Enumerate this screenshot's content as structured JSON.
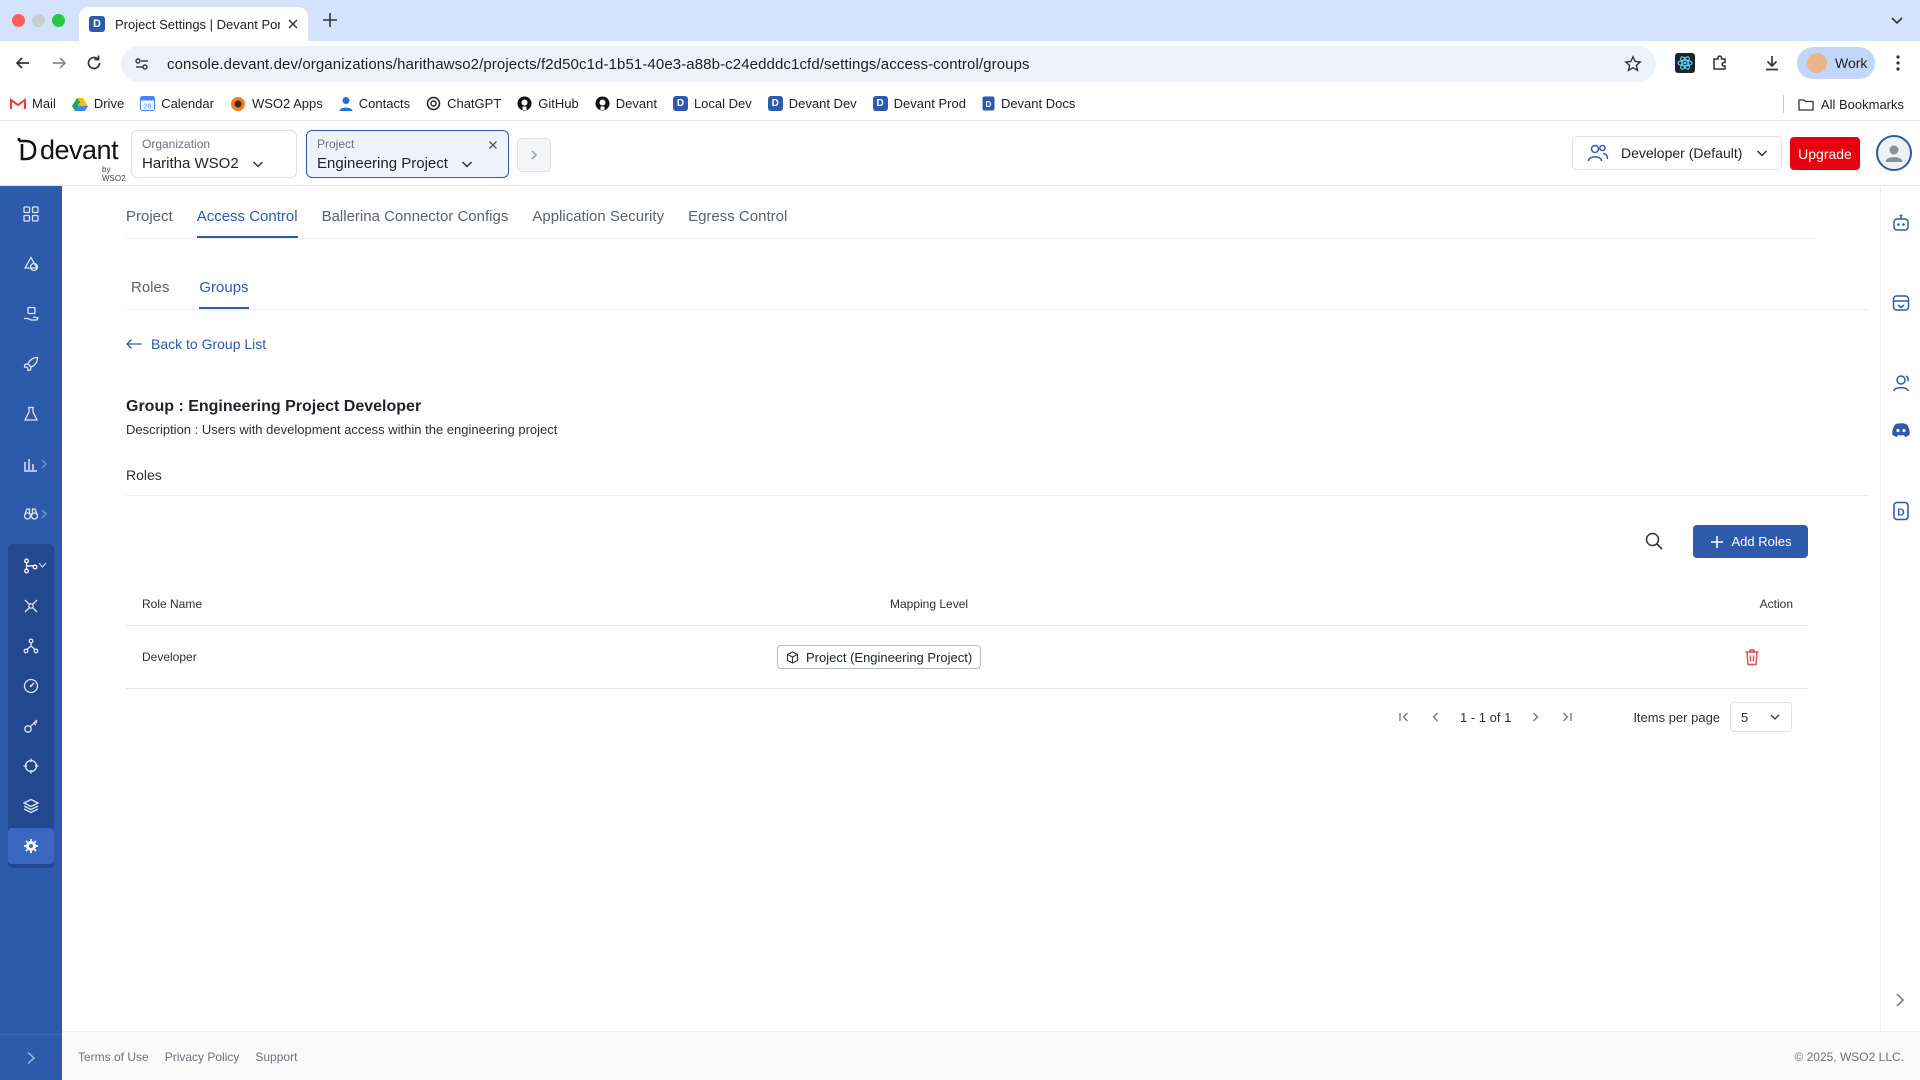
{
  "browser": {
    "tab_title": "Project Settings | Devant Portal",
    "url": "console.devant.dev/organizations/harithawso2/projects/f2d50c1d-1b51-40e3-a88b-c24edddc1cfd/settings/access-control/groups",
    "profile_label": "Work",
    "bookmarks": [
      "Mail",
      "Drive",
      "Calendar",
      "WSO2 Apps",
      "Contacts",
      "ChatGPT",
      "GitHub",
      "Devant",
      "Local Dev",
      "Devant Dev",
      "Devant Prod",
      "Devant Docs"
    ],
    "all_bookmarks": "All Bookmarks"
  },
  "header": {
    "logo_text": "devant",
    "logo_by": "by WSO2",
    "org_label": "Organization",
    "org_value": "Haritha WSO2",
    "project_label": "Project",
    "project_value": "Engineering Project",
    "role_switch": "Developer (Default)",
    "upgrade_label": "Upgrade"
  },
  "settings_tabs": [
    "Project",
    "Access Control",
    "Ballerina Connector Configs",
    "Application Security",
    "Egress Control"
  ],
  "access_tabs": [
    "Roles",
    "Groups"
  ],
  "group": {
    "back_label": "Back to Group List",
    "title": "Group : Engineering Project Developer",
    "description": "Description : Users with development access within the engineering project",
    "roles_heading": "Roles",
    "add_roles_label": "Add Roles"
  },
  "table": {
    "columns": [
      "Role Name",
      "Mapping Level",
      "Action"
    ],
    "rows": [
      {
        "role": "Developer",
        "mapping": "Project (Engineering Project)"
      }
    ]
  },
  "pagination": {
    "range": "1 - 1 of 1",
    "items_per_page_label": "Items per page",
    "items_per_page": "5"
  },
  "footer": {
    "links": [
      "Terms of Use",
      "Privacy Policy",
      "Support"
    ],
    "copyright": "© 2025, WSO2 LLC."
  },
  "colors": {
    "brand": "#2e5aac",
    "upgrade": "#e8000f",
    "delete": "#e5484d"
  }
}
